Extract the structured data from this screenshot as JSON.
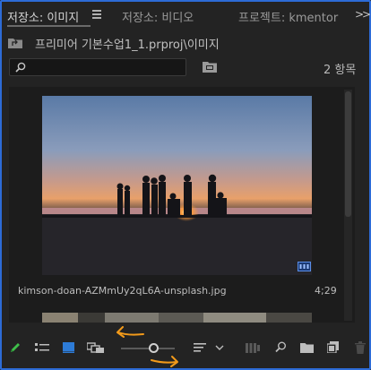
{
  "tabs": [
    {
      "label": "저장소: 이미지",
      "active": true
    },
    {
      "label": "저장소: 비디오",
      "active": false
    },
    {
      "label": "프로젝트: kmentor",
      "active": false
    }
  ],
  "panel_menu_icon": "hamburger-menu-icon",
  "overflow_icon": "double-chevron-right-icon",
  "path": {
    "icon": "folder-up-icon",
    "text": "프리미어 기본수업1_1.prproj\\이미지"
  },
  "search": {
    "placeholder": "",
    "icon": "search-icon"
  },
  "new_bin_icon": "new-bin-icon",
  "item_count": "2 항목",
  "clips": [
    {
      "name": "kimson-doan-AZMmUy2qL6A-unsplash.jpg",
      "duration": "4;29"
    }
  ],
  "zoom": {
    "level": 0.6
  },
  "toolbar_icons": [
    "write-pencil-icon",
    "list-view-icon",
    "icon-view-icon",
    "freeform-view-icon",
    "zoom-slider",
    "sort-icon",
    "dropdown-chevron-icon",
    "automate-sequence-icon",
    "find-icon",
    "new-bin-icon",
    "new-item-icon",
    "trash-icon"
  ],
  "colors": {
    "panel_border": "#2d6bd6",
    "accent_blue": "#2d7bd6",
    "pencil_green": "#3fbf4a",
    "annotation_orange": "#f29a1a",
    "background": "#232323"
  }
}
